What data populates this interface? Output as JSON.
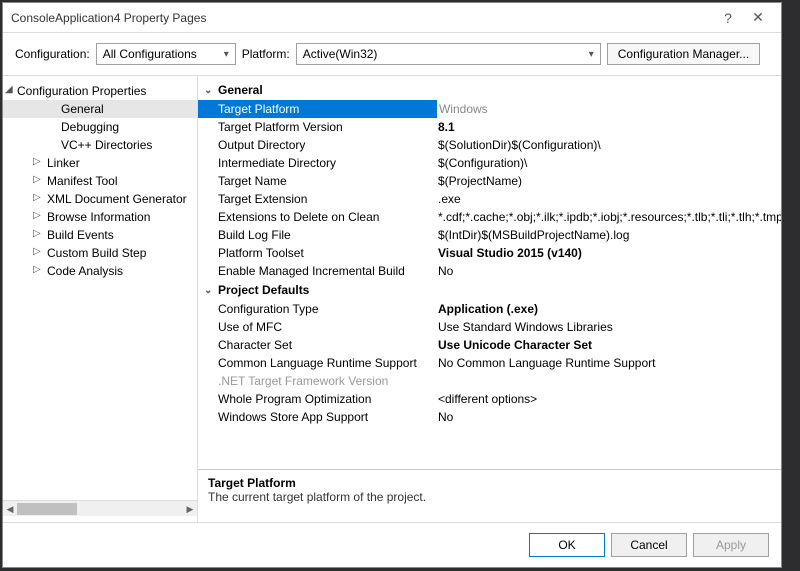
{
  "window": {
    "title": "ConsoleApplication4 Property Pages",
    "help": "?",
    "close": "✕"
  },
  "configRow": {
    "configLabel": "Configuration:",
    "configValue": "All Configurations",
    "platformLabel": "Platform:",
    "platformValue": "Active(Win32)",
    "managerBtn": "Configuration Manager..."
  },
  "tree": {
    "root": "Configuration Properties",
    "items": [
      {
        "label": "General",
        "selected": true
      },
      {
        "label": "Debugging"
      },
      {
        "label": "VC++ Directories"
      },
      {
        "label": "Linker",
        "expandable": true
      },
      {
        "label": "Manifest Tool",
        "expandable": true
      },
      {
        "label": "XML Document Generator",
        "expandable": true
      },
      {
        "label": "Browse Information",
        "expandable": true
      },
      {
        "label": "Build Events",
        "expandable": true
      },
      {
        "label": "Custom Build Step",
        "expandable": true
      },
      {
        "label": "Code Analysis",
        "expandable": true
      }
    ]
  },
  "groups": {
    "general": "General",
    "defaults": "Project Defaults"
  },
  "props": {
    "targetPlatform": {
      "label": "Target Platform",
      "value": "Windows"
    },
    "targetPlatformVersion": {
      "label": "Target Platform Version",
      "value": "8.1"
    },
    "outputDirectory": {
      "label": "Output Directory",
      "value": "$(SolutionDir)$(Configuration)\\"
    },
    "intermediateDirectory": {
      "label": "Intermediate Directory",
      "value": "$(Configuration)\\"
    },
    "targetName": {
      "label": "Target Name",
      "value": "$(ProjectName)"
    },
    "targetExtension": {
      "label": "Target Extension",
      "value": ".exe"
    },
    "extensionsDelete": {
      "label": "Extensions to Delete on Clean",
      "value": "*.cdf;*.cache;*.obj;*.ilk;*.ipdb;*.iobj;*.resources;*.tlb;*.tli;*.tlh;*.tmp;*"
    },
    "buildLogFile": {
      "label": "Build Log File",
      "value": "$(IntDir)$(MSBuildProjectName).log"
    },
    "platformToolset": {
      "label": "Platform Toolset",
      "value": "Visual Studio 2015 (v140)"
    },
    "enableManagedIncremental": {
      "label": "Enable Managed Incremental Build",
      "value": "No"
    },
    "configurationType": {
      "label": "Configuration Type",
      "value": "Application (.exe)"
    },
    "useOfMFC": {
      "label": "Use of MFC",
      "value": "Use Standard Windows Libraries"
    },
    "characterSet": {
      "label": "Character Set",
      "value": "Use Unicode Character Set"
    },
    "clrSupport": {
      "label": "Common Language Runtime Support",
      "value": "No Common Language Runtime Support"
    },
    "netFramework": {
      "label": ".NET Target Framework Version",
      "value": ""
    },
    "wholeProgramOpt": {
      "label": "Whole Program Optimization",
      "value": "<different options>"
    },
    "winStoreSupport": {
      "label": "Windows Store App Support",
      "value": "No"
    }
  },
  "description": {
    "title": "Target Platform",
    "text": "The current target platform of the project."
  },
  "footer": {
    "ok": "OK",
    "cancel": "Cancel",
    "apply": "Apply"
  }
}
